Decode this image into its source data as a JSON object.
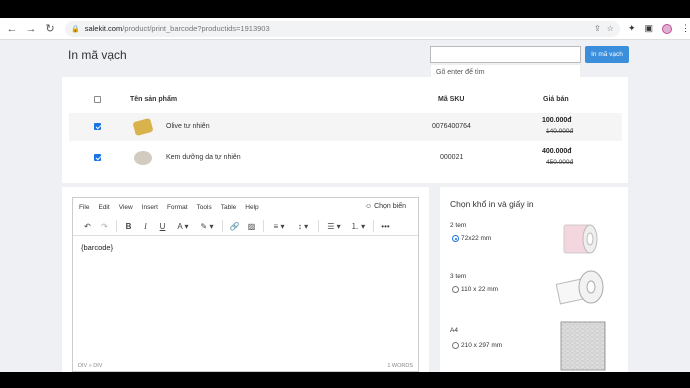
{
  "browser": {
    "url_host": "salekit.com",
    "url_path": "/product/print_barcode?productids=1913903"
  },
  "page": {
    "title": "In mã vạch",
    "search": {
      "placeholder": "",
      "button_label": "In mã vạch",
      "hint": "Gõ enter để tìm"
    }
  },
  "products": {
    "headers": {
      "name": "Tên sản phẩm",
      "sku": "Mã SKU",
      "price": "Giá bán"
    },
    "rows": [
      {
        "checked": true,
        "name": "Olive tư nhiên",
        "sku": "0076400764",
        "price": "100.000đ",
        "old_price": "140.000đ",
        "image_color": "#d8b24a"
      },
      {
        "checked": true,
        "name": "Kem dưỡng da tự nhiên",
        "sku": "000021",
        "price": "400.000đ",
        "old_price": "450.000đ",
        "image_color": "#c8c0b4"
      }
    ]
  },
  "editor": {
    "menus": [
      "File",
      "Edit",
      "View",
      "Insert",
      "Format",
      "Tools",
      "Table",
      "Help"
    ],
    "right_menu": "☺ Chọn biến",
    "content": "{barcode}",
    "status_left": "DIV » DIV",
    "status_right": "1 WORDS"
  },
  "paper": {
    "title": "Chọn khổ in và giấy in",
    "options": [
      {
        "group": "2 tem",
        "label": "72x22 mm",
        "selected": true
      },
      {
        "group": "3 tem",
        "label": "110 x 22 mm",
        "selected": false
      },
      {
        "group": "A4",
        "label": "210 x 297 mm",
        "selected": false
      }
    ]
  }
}
